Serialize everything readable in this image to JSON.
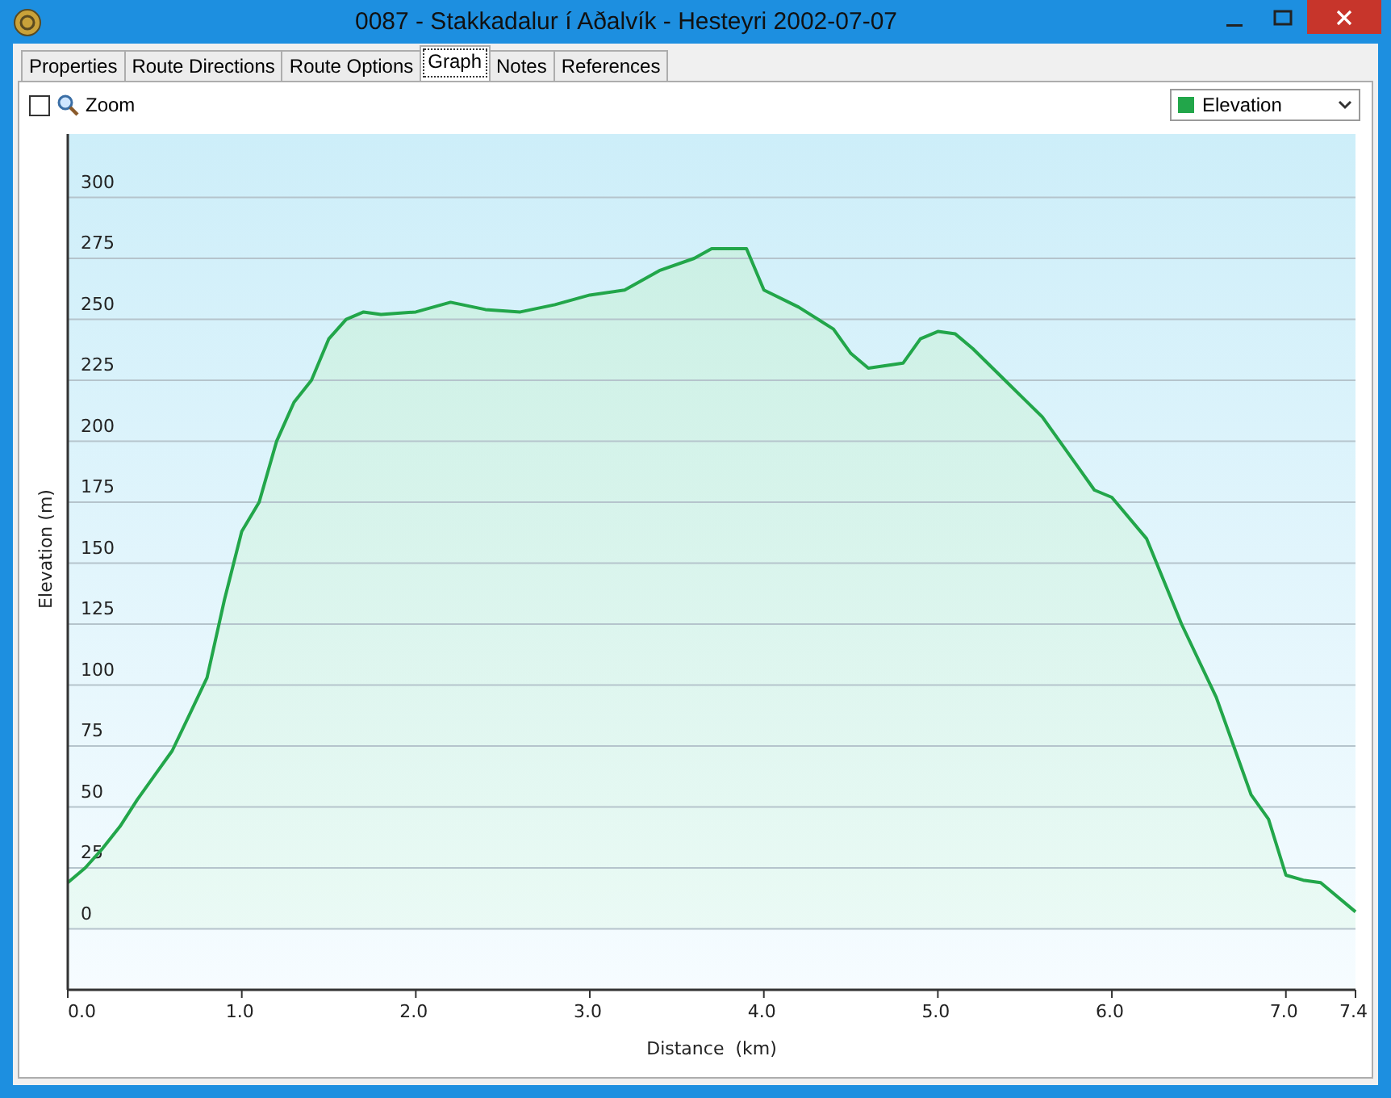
{
  "window": {
    "title": "0087 - Stakkadalur í Aðalvík - Hesteyri 2002-07-07"
  },
  "tabs": [
    {
      "label": "Properties",
      "selected": false
    },
    {
      "label": "Route Directions",
      "selected": false
    },
    {
      "label": "Route Options",
      "selected": false
    },
    {
      "label": "Graph",
      "selected": true
    },
    {
      "label": "Notes",
      "selected": false
    },
    {
      "label": "References",
      "selected": false
    }
  ],
  "zoom": {
    "label": "Zoom",
    "checked": false
  },
  "graph": {
    "chart_data": {
      "type": "area",
      "grid": true,
      "xlabel": "Distance  (km)",
      "ylabel": "Elevation (m)",
      "x": [
        0,
        0.1,
        0.2,
        0.3,
        0.4,
        0.5,
        0.6,
        0.7,
        0.8,
        0.9,
        1.0,
        1.1,
        1.2,
        1.3,
        1.4,
        1.5,
        1.6,
        1.7,
        1.8,
        2.0,
        2.2,
        2.4,
        2.6,
        2.8,
        3.0,
        3.2,
        3.4,
        3.6,
        3.7,
        3.9,
        4.0,
        4.2,
        4.4,
        4.5,
        4.6,
        4.8,
        4.9,
        5.0,
        5.1,
        5.2,
        5.4,
        5.6,
        5.8,
        5.9,
        6.0,
        6.2,
        6.4,
        6.6,
        6.7,
        6.8,
        6.9,
        7.0,
        7.1,
        7.2,
        7.4
      ],
      "series": [
        {
          "name": "Elevation",
          "color": "#22a64a",
          "values": [
            19,
            25,
            33,
            42,
            53,
            63,
            73,
            88,
            103,
            135,
            163,
            175,
            200,
            216,
            225,
            242,
            250,
            253,
            252,
            253,
            257,
            254,
            253,
            256,
            260,
            262,
            270,
            275,
            279,
            279,
            262,
            255,
            246,
            236,
            230,
            232,
            242,
            245,
            244,
            238,
            224,
            210,
            190,
            180,
            177,
            160,
            125,
            95,
            75,
            55,
            45,
            22,
            20,
            19,
            7
          ]
        }
      ],
      "xlim": [
        0,
        7.4
      ],
      "ylim": [
        -25,
        326
      ],
      "xticks": [
        {
          "value": 0,
          "label": "0.0"
        },
        {
          "value": 1,
          "label": "1.0"
        },
        {
          "value": 2,
          "label": "2.0"
        },
        {
          "value": 3,
          "label": "3.0"
        },
        {
          "value": 4,
          "label": "4.0"
        },
        {
          "value": 5,
          "label": "5.0"
        },
        {
          "value": 6,
          "label": "6.0"
        },
        {
          "value": 7,
          "label": "7.0"
        },
        {
          "value": 7.4,
          "label": "7.4"
        }
      ],
      "yticks": [
        0,
        25,
        50,
        75,
        100,
        125,
        150,
        175,
        200,
        225,
        250,
        275,
        300
      ]
    }
  }
}
